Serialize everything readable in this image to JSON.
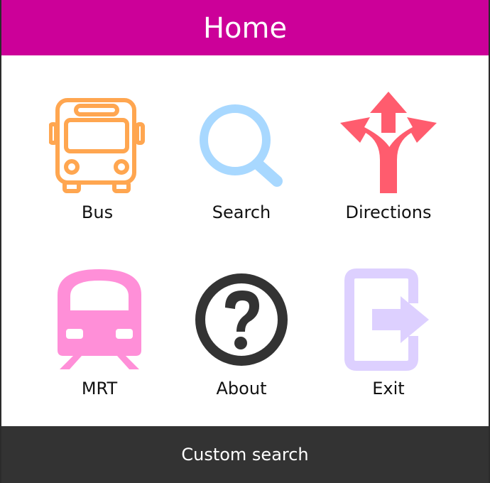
{
  "header": {
    "title": "Home"
  },
  "colors": {
    "header_bg": "#cc0099",
    "footer_bg": "#333333",
    "bus": "#ffa650",
    "search": "#a8d8ff",
    "directions": "#ff5c6e",
    "mrt": "#ff8fd8",
    "about": "#333333",
    "exit": "#ddd0ff"
  },
  "menu": {
    "items": [
      {
        "label": "Bus",
        "icon": "bus-icon"
      },
      {
        "label": "Search",
        "icon": "search-icon"
      },
      {
        "label": "Directions",
        "icon": "directions-icon"
      },
      {
        "label": "MRT",
        "icon": "train-icon"
      },
      {
        "label": "About",
        "icon": "help-icon"
      },
      {
        "label": "Exit",
        "icon": "exit-icon"
      }
    ]
  },
  "footer": {
    "label": "Custom search"
  }
}
